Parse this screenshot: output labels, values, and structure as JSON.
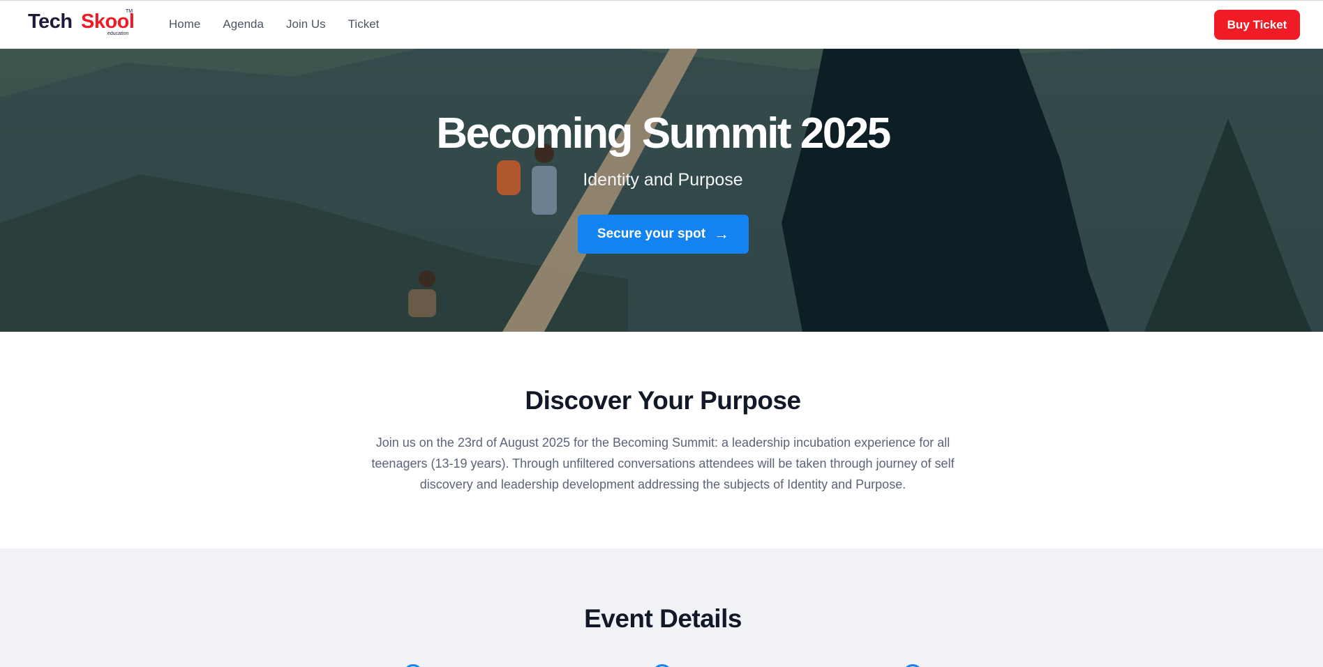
{
  "nav": {
    "logo": {
      "tech": "Tech",
      "skool": "Skool",
      "tm": "TM",
      "edu": "education"
    },
    "links": [
      "Home",
      "Agenda",
      "Join Us",
      "Ticket"
    ],
    "buy_ticket": "Buy Ticket"
  },
  "hero": {
    "title": "Becoming Summit 2025",
    "subtitle": "Identity and Purpose",
    "cta_label": "Secure your spot",
    "cta_icon": "arrow-right-icon"
  },
  "discover": {
    "title": "Discover Your Purpose",
    "text": "Join us on the 23rd of August 2025 for the Becoming Summit: a leadership incubation experience for all teenagers (13-19 years). Through unfiltered conversations attendees will be taken through journey of self discovery and leadership development addressing the subjects of Identity and Purpose."
  },
  "event": {
    "title": "Event Details"
  },
  "colors": {
    "brand_red": "#ef1c25",
    "brand_navy": "#1e1b3a",
    "cta_blue": "#1283f0",
    "body_text": "#5b6477"
  }
}
